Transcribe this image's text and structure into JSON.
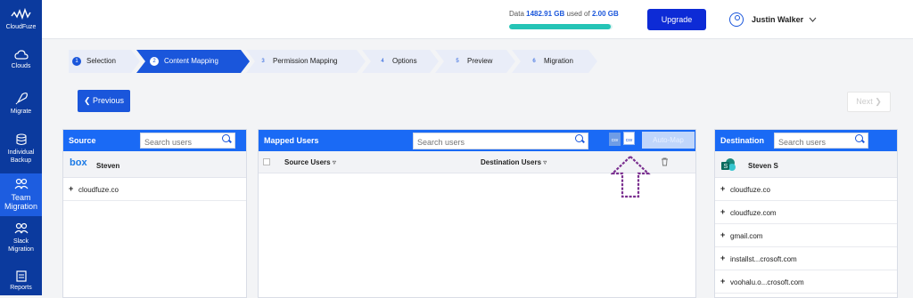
{
  "sidebar": {
    "brand": "CloudFuze",
    "items": [
      {
        "label": "Clouds",
        "icon": "cloud-icon"
      },
      {
        "label": "Migrate",
        "icon": "rocket-icon"
      },
      {
        "label": "Individual Backup",
        "icon": "database-icon"
      },
      {
        "label": "Team Migration",
        "icon": "team-icon"
      },
      {
        "label": "Slack Migration",
        "icon": "slack-team-icon"
      },
      {
        "label": "Reports",
        "icon": "reports-icon"
      }
    ]
  },
  "header": {
    "quota_prefix": "Data ",
    "quota_used": "1482.91 GB",
    "quota_mid": " used of ",
    "quota_total": "2.00 GB",
    "quota_fraction": 0.98,
    "upgrade_label": "Upgrade",
    "user_name": "Justin Walker"
  },
  "steps": [
    {
      "num": "1",
      "label": "Selection"
    },
    {
      "num": "2",
      "label": "Content Mapping"
    },
    {
      "num": "3",
      "label": "Permission Mapping"
    },
    {
      "num": "4",
      "label": "Options"
    },
    {
      "num": "5",
      "label": "Preview"
    },
    {
      "num": "6",
      "label": "Migration"
    }
  ],
  "nav": {
    "previous_label": "Previous",
    "next_label": "Next"
  },
  "source": {
    "title": "Source",
    "search_placeholder": "Search users",
    "account_logo": "box",
    "account_name": "Steven",
    "domains": [
      "cloudfuze.co"
    ]
  },
  "mapped": {
    "title": "Mapped Users",
    "search_placeholder": "Search users",
    "col_source": "Source Users",
    "col_destination": "Destination Users",
    "csv_label": "csv",
    "automap_label": "Auto-Map"
  },
  "destination": {
    "title": "Destination",
    "search_placeholder": "Search users",
    "account_name": "Steven S",
    "domains": [
      "cloudfuze.co",
      "cloudfuze.com",
      "gmail.com",
      "installst...crosoft.com",
      "voohalu.o...crosoft.com"
    ]
  },
  "colors": {
    "sidebar": "#0b3a9e",
    "accent": "#1a56db",
    "panel_head": "#1a6af5",
    "annotation_arrow": "#7a2f8f"
  }
}
